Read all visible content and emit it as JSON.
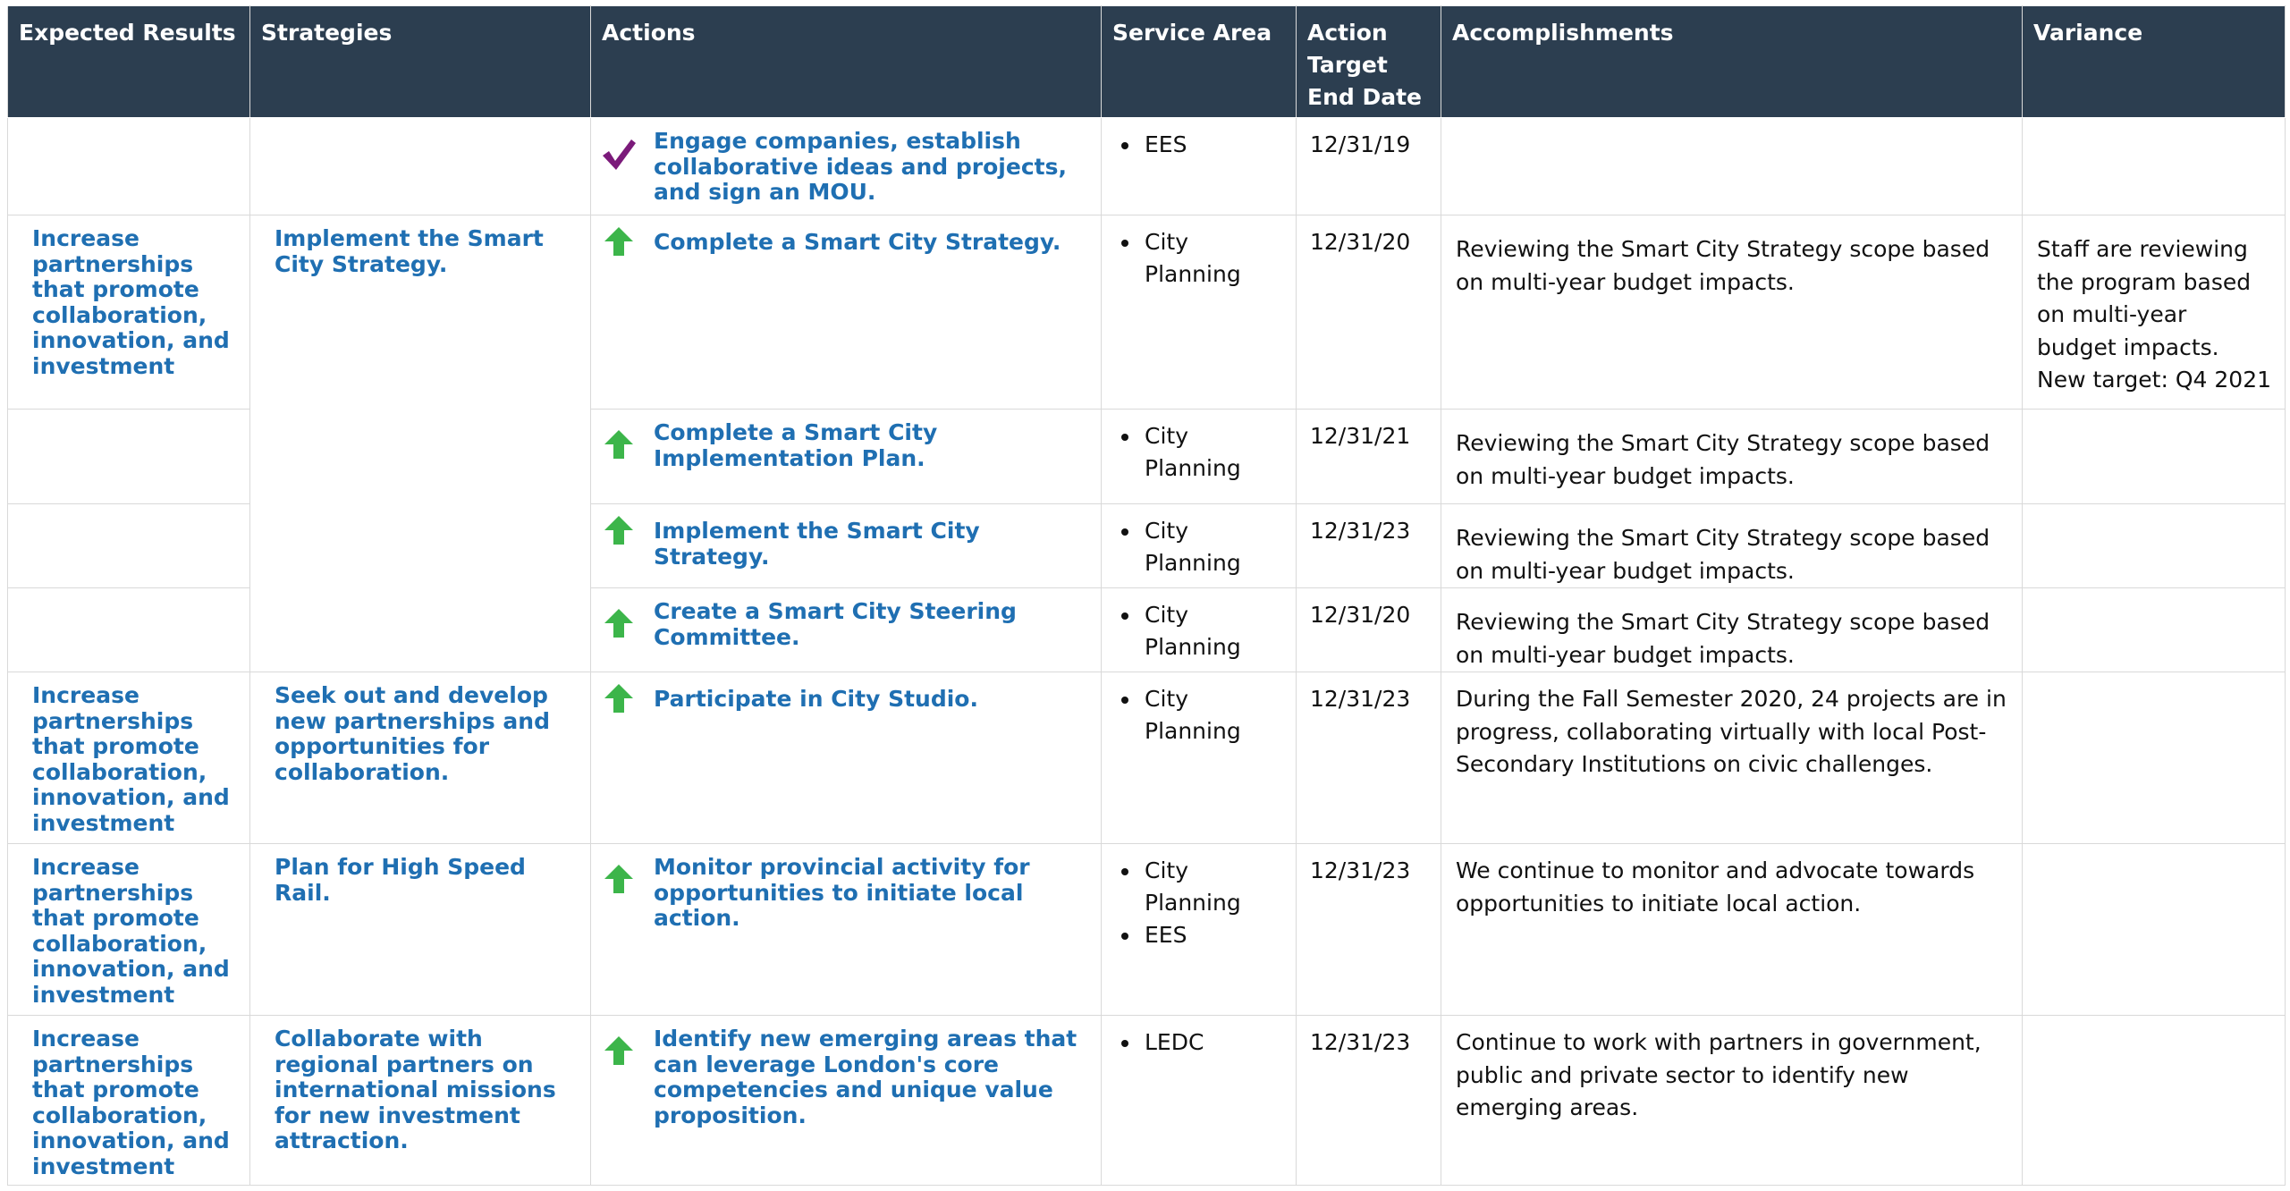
{
  "headers": {
    "expected_results": "Expected Results",
    "strategies": "Strategies",
    "actions": "Actions",
    "service_area": "Service Area",
    "target_date": "Action Target End Date",
    "accomplishments": "Accomplishments",
    "variance": "Variance"
  },
  "colors": {
    "header_bg": "#2c3e50",
    "link_blue": "#1f6fb2",
    "arrow_green": "#3cb54a",
    "check_purple": "#7b1a7a"
  },
  "rows": [
    {
      "expected": "",
      "strategy": "",
      "action": "Engage companies, establish collaborative ideas and projects, and sign an MOU.",
      "status_icon": "checkmark-icon",
      "service_area": [
        "EES"
      ],
      "date": "12/31/19",
      "accomplishment": "",
      "variance": ""
    },
    {
      "expected": "Increase partnerships that promote collaboration, innovation, and investment",
      "strategy": "Implement the Smart City Strategy.",
      "action": "Complete a Smart City Strategy.",
      "status_icon": "up-arrow-icon",
      "service_area": [
        "City Planning"
      ],
      "date": "12/31/20",
      "accomplishment": "Reviewing the Smart City Strategy scope based on multi-year budget impacts.",
      "variance": "Staff are reviewing the program based on multi-year budget impacts. New target: Q4 2021"
    },
    {
      "expected": "",
      "action": "Complete a Smart City Implementation Plan.",
      "status_icon": "up-arrow-icon",
      "service_area": [
        "City Planning"
      ],
      "date": "12/31/21",
      "accomplishment": "Reviewing the Smart City Strategy scope based on multi-year budget impacts.",
      "variance": ""
    },
    {
      "expected": "",
      "action": "Implement the Smart City Strategy.",
      "status_icon": "up-arrow-icon",
      "service_area": [
        "City Planning"
      ],
      "date": "12/31/23",
      "accomplishment": "Reviewing the Smart City Strategy scope based on multi-year budget impacts.",
      "variance": ""
    },
    {
      "expected": "",
      "action": "Create a Smart City Steering Committee.",
      "status_icon": "up-arrow-icon",
      "service_area": [
        "City Planning"
      ],
      "date": "12/31/20",
      "accomplishment": "Reviewing the Smart City Strategy scope based on multi-year budget impacts.",
      "variance": ""
    },
    {
      "expected": "Increase partnerships that promote collaboration, innovation, and investment",
      "strategy": "Seek out and develop new partnerships and opportunities for collaboration.",
      "action": "Participate in City Studio.",
      "status_icon": "up-arrow-icon",
      "service_area": [
        "City Planning"
      ],
      "date": "12/31/23",
      "accomplishment": "During the Fall Semester 2020, 24 projects are in progress, collaborating virtually with local Post-Secondary Institutions on civic challenges.",
      "variance": ""
    },
    {
      "expected": "Increase partnerships that promote collaboration, innovation, and investment",
      "strategy": "Plan for High Speed Rail.",
      "action": "Monitor provincial activity for opportunities to initiate local action.",
      "status_icon": "up-arrow-icon",
      "service_area": [
        "City Planning",
        "EES"
      ],
      "date": "12/31/23",
      "accomplishment": "We continue to monitor and advocate towards opportunities to initiate local action.",
      "variance": ""
    },
    {
      "expected": "Increase partnerships that promote collaboration, innovation, and investment",
      "strategy": "Collaborate with regional partners on international missions for new investment attraction.",
      "action": "Identify new emerging areas that can leverage London's core competencies and unique value proposition.",
      "status_icon": "up-arrow-icon",
      "service_area": [
        "LEDC"
      ],
      "date": "12/31/23",
      "accomplishment": "Continue to work with partners in government, public and private sector to identify new emerging areas.",
      "variance": ""
    }
  ]
}
